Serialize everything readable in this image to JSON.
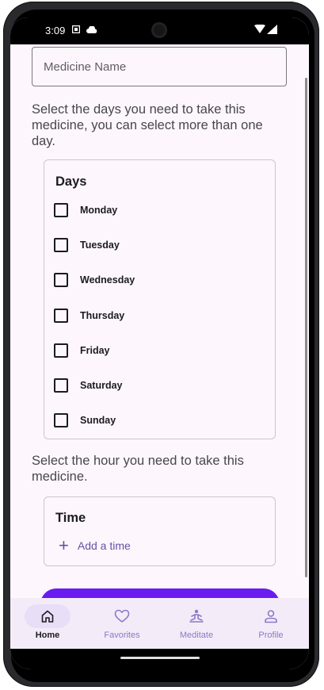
{
  "status_bar": {
    "time": "3:09"
  },
  "form": {
    "medicine_name_placeholder": "Medicine Name",
    "days_instruction": "Select the days you need to take this medicine, you can select more than one day.",
    "hour_instruction": "Select the hour you need to take this medicine."
  },
  "days_card": {
    "title": "Days",
    "days": [
      "Monday",
      "Tuesday",
      "Wednesday",
      "Thursday",
      "Friday",
      "Saturday",
      "Sunday"
    ]
  },
  "time_card": {
    "title": "Time",
    "add_label": "Add a time"
  },
  "nav": {
    "items": [
      {
        "label": "Home",
        "icon": "home-icon",
        "active": true
      },
      {
        "label": "Favorites",
        "icon": "heart-icon",
        "active": false
      },
      {
        "label": "Meditate",
        "icon": "meditate-icon",
        "active": false
      },
      {
        "label": "Profile",
        "icon": "person-icon",
        "active": false
      }
    ]
  },
  "colors": {
    "primary": "#6a1bf0",
    "accent_text": "#6750a4",
    "nav_background": "#f3ecf8",
    "active_indicator": "#e8def8"
  }
}
